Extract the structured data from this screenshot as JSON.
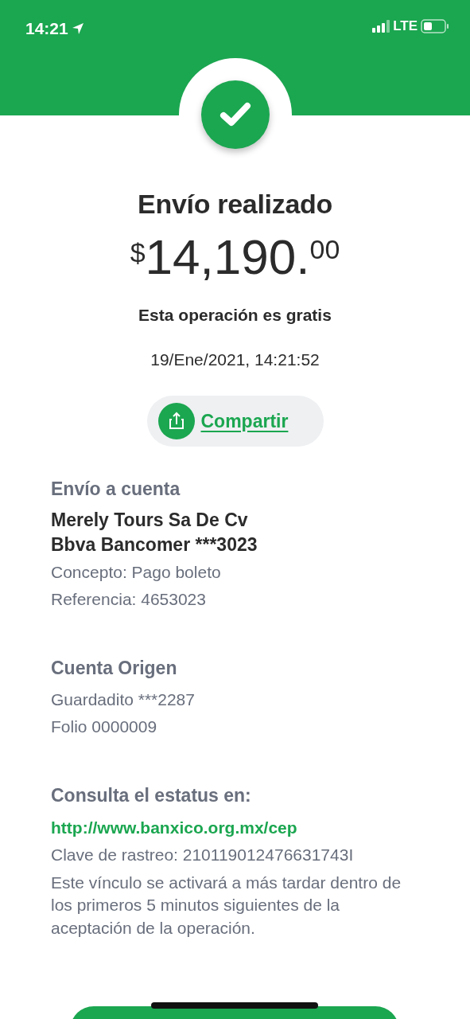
{
  "status_bar": {
    "time": "14:21",
    "network": "LTE"
  },
  "title": "Envío realizado",
  "amount": {
    "currency": "$",
    "whole": "14,190.",
    "cents": "00"
  },
  "fee_note": "Esta operación es gratis",
  "datetime": "19/Ene/2021, 14:21:52",
  "share_button": {
    "label": "Compartir"
  },
  "sections": [
    {
      "heading": "Envío a cuenta",
      "lines": [
        {
          "kind": "strong",
          "text": "Merely Tours Sa De Cv"
        },
        {
          "kind": "strong",
          "text": "Bbva Bancomer ***3023"
        },
        {
          "kind": "plain",
          "text": "Concepto: Pago boleto"
        },
        {
          "kind": "plain",
          "text": "Referencia: 4653023"
        }
      ]
    },
    {
      "heading": "Cuenta Origen",
      "lines": [
        {
          "kind": "plain",
          "text": "Guardadito ***2287"
        },
        {
          "kind": "plain",
          "text": "Folio 0000009"
        }
      ]
    },
    {
      "heading": "Consulta el estatus en:",
      "lines": [
        {
          "kind": "link",
          "text": "http://www.banxico.org.mx/cep"
        },
        {
          "kind": "plain",
          "text": "Clave de rastreo: 210119012476631743I"
        },
        {
          "kind": "note",
          "text": "Este vínculo se activará a más tardar dentro de los primeros 5 minutos siguientes de la aceptación de la operación."
        }
      ]
    }
  ]
}
